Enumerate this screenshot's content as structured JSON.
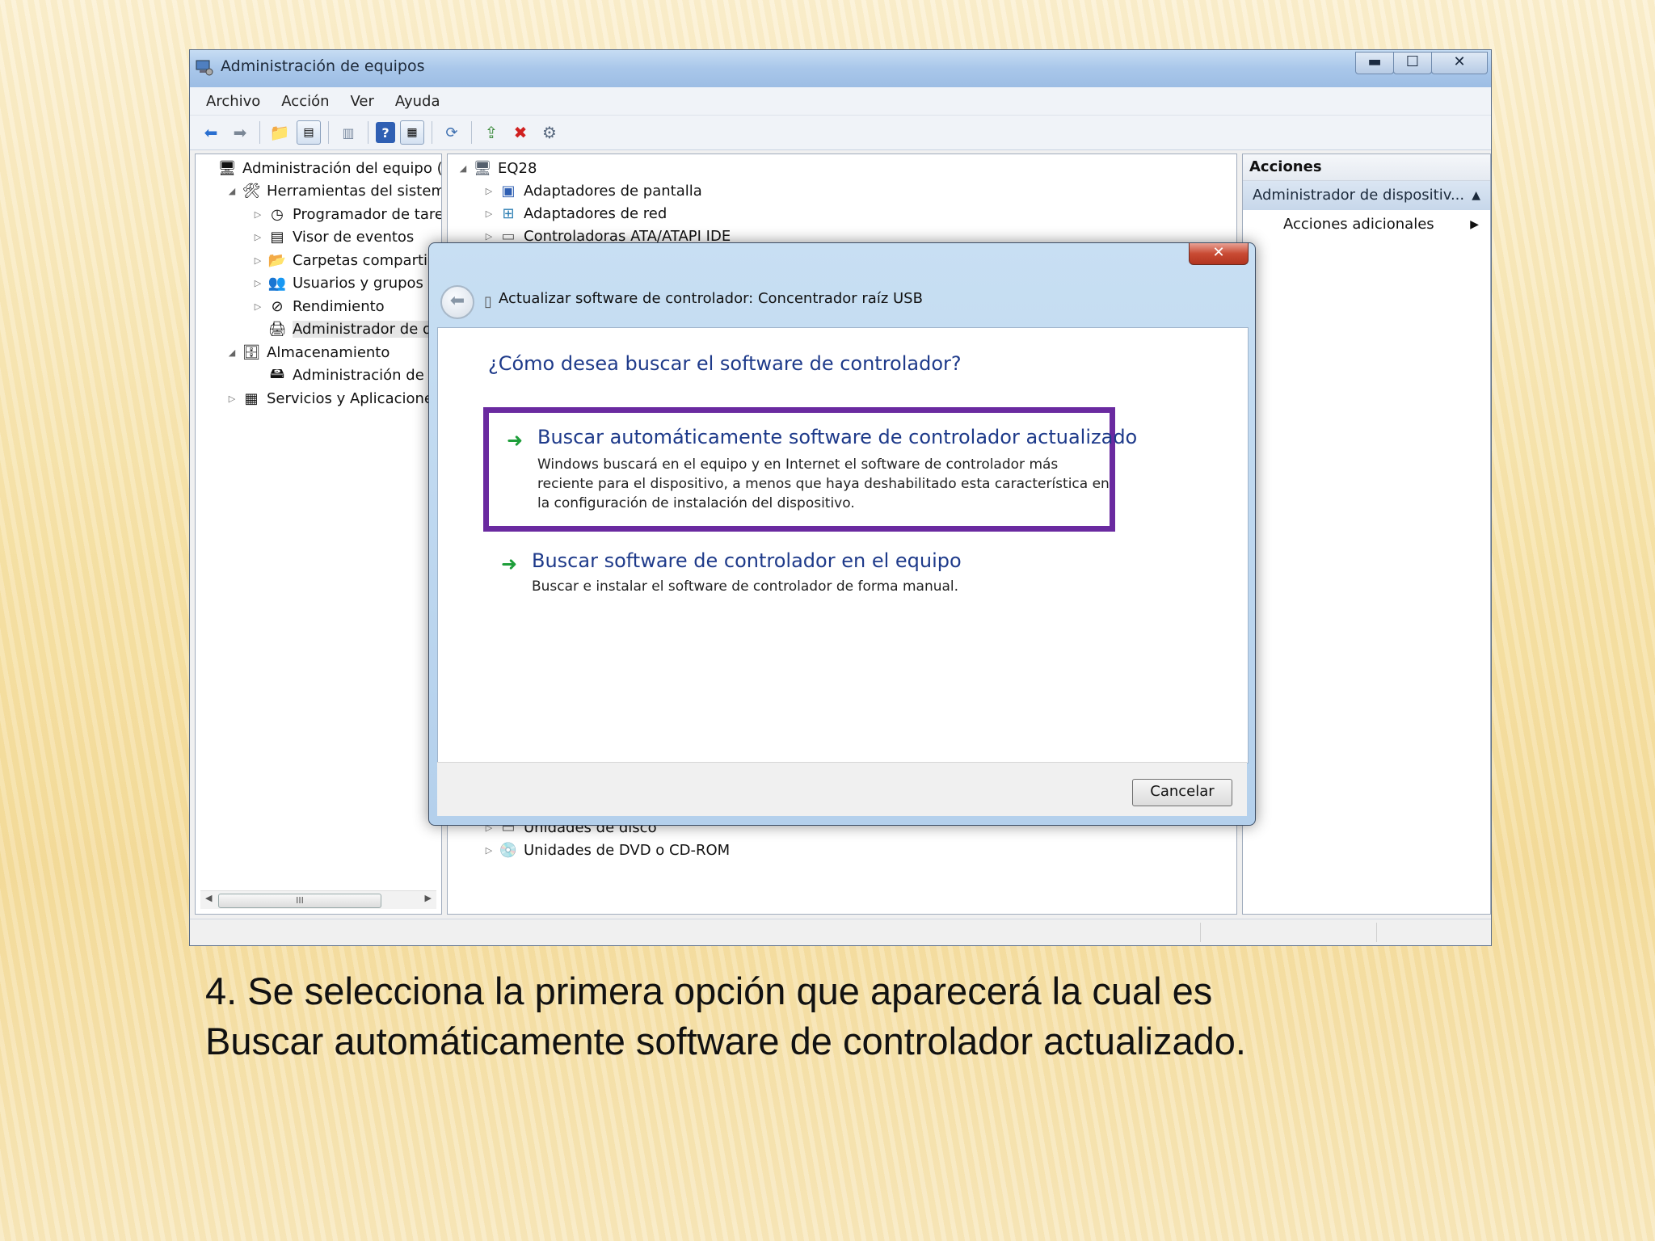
{
  "window": {
    "title": "Administración de equipos",
    "caption_buttons": {
      "minimize": "▬",
      "maximize": "☐",
      "close": "✕"
    },
    "menu": [
      "Archivo",
      "Acción",
      "Ver",
      "Ayuda"
    ]
  },
  "tree": {
    "items": [
      {
        "label": "Administración del equipo (loc",
        "icon": "computer-icon",
        "level": 0,
        "arrow": ""
      },
      {
        "label": "Herramientas del sistema",
        "icon": "tools-icon",
        "level": 1,
        "arrow": "◢"
      },
      {
        "label": "Programador de tareas",
        "icon": "clock-icon",
        "level": 2,
        "arrow": "▷"
      },
      {
        "label": "Visor de eventos",
        "icon": "event-viewer-icon",
        "level": 2,
        "arrow": "▷"
      },
      {
        "label": "Carpetas compartidas",
        "icon": "shared-folder-icon",
        "level": 2,
        "arrow": "▷"
      },
      {
        "label": "Usuarios y grupos loc",
        "icon": "users-icon",
        "level": 2,
        "arrow": "▷"
      },
      {
        "label": "Rendimiento",
        "icon": "performance-icon",
        "level": 2,
        "arrow": "▷"
      },
      {
        "label": "Administrador de disp",
        "icon": "device-manager-icon",
        "level": 2,
        "arrow": "",
        "selected": true
      },
      {
        "label": "Almacenamiento",
        "icon": "storage-icon",
        "level": 1,
        "arrow": "◢"
      },
      {
        "label": "Administración de dis",
        "icon": "disk-icon",
        "level": 2,
        "arrow": ""
      },
      {
        "label": "Servicios y Aplicaciones",
        "icon": "services-icon",
        "level": 1,
        "arrow": "▷"
      }
    ],
    "scroll_thumb": "III"
  },
  "devices": {
    "root": "EQ28",
    "items_top": [
      "Adaptadores de pantalla",
      "Adaptadores de red",
      "Controladoras ATA/ATAPI IDE"
    ],
    "items_bottom": [
      "Unidades de disco",
      "Unidades de DVD o CD-ROM"
    ]
  },
  "actions": {
    "header": "Acciones",
    "section": "Administrador de dispositiv...",
    "item": "Acciones adicionales"
  },
  "dialog": {
    "title": "Actualizar software de controlador: Concentrador raíz USB",
    "question": "¿Cómo desea buscar el software de controlador?",
    "option1": {
      "title": "Buscar automáticamente software de controlador actualizado",
      "desc": "Windows buscará en el equipo y en Internet el software de controlador más reciente para el dispositivo, a menos que haya deshabilitado esta característica en la configuración de instalación del dispositivo."
    },
    "option2": {
      "title": "Buscar software de controlador en el equipo",
      "desc": "Buscar e instalar el software de controlador de forma manual."
    },
    "cancel": "Cancelar",
    "close": "✕",
    "highlight_color": "#6a2aa0"
  },
  "caption": {
    "line1": "4. Se selecciona la primera opción que aparecerá la cual es",
    "line2": "Buscar automáticamente software de controlador actualizado."
  }
}
